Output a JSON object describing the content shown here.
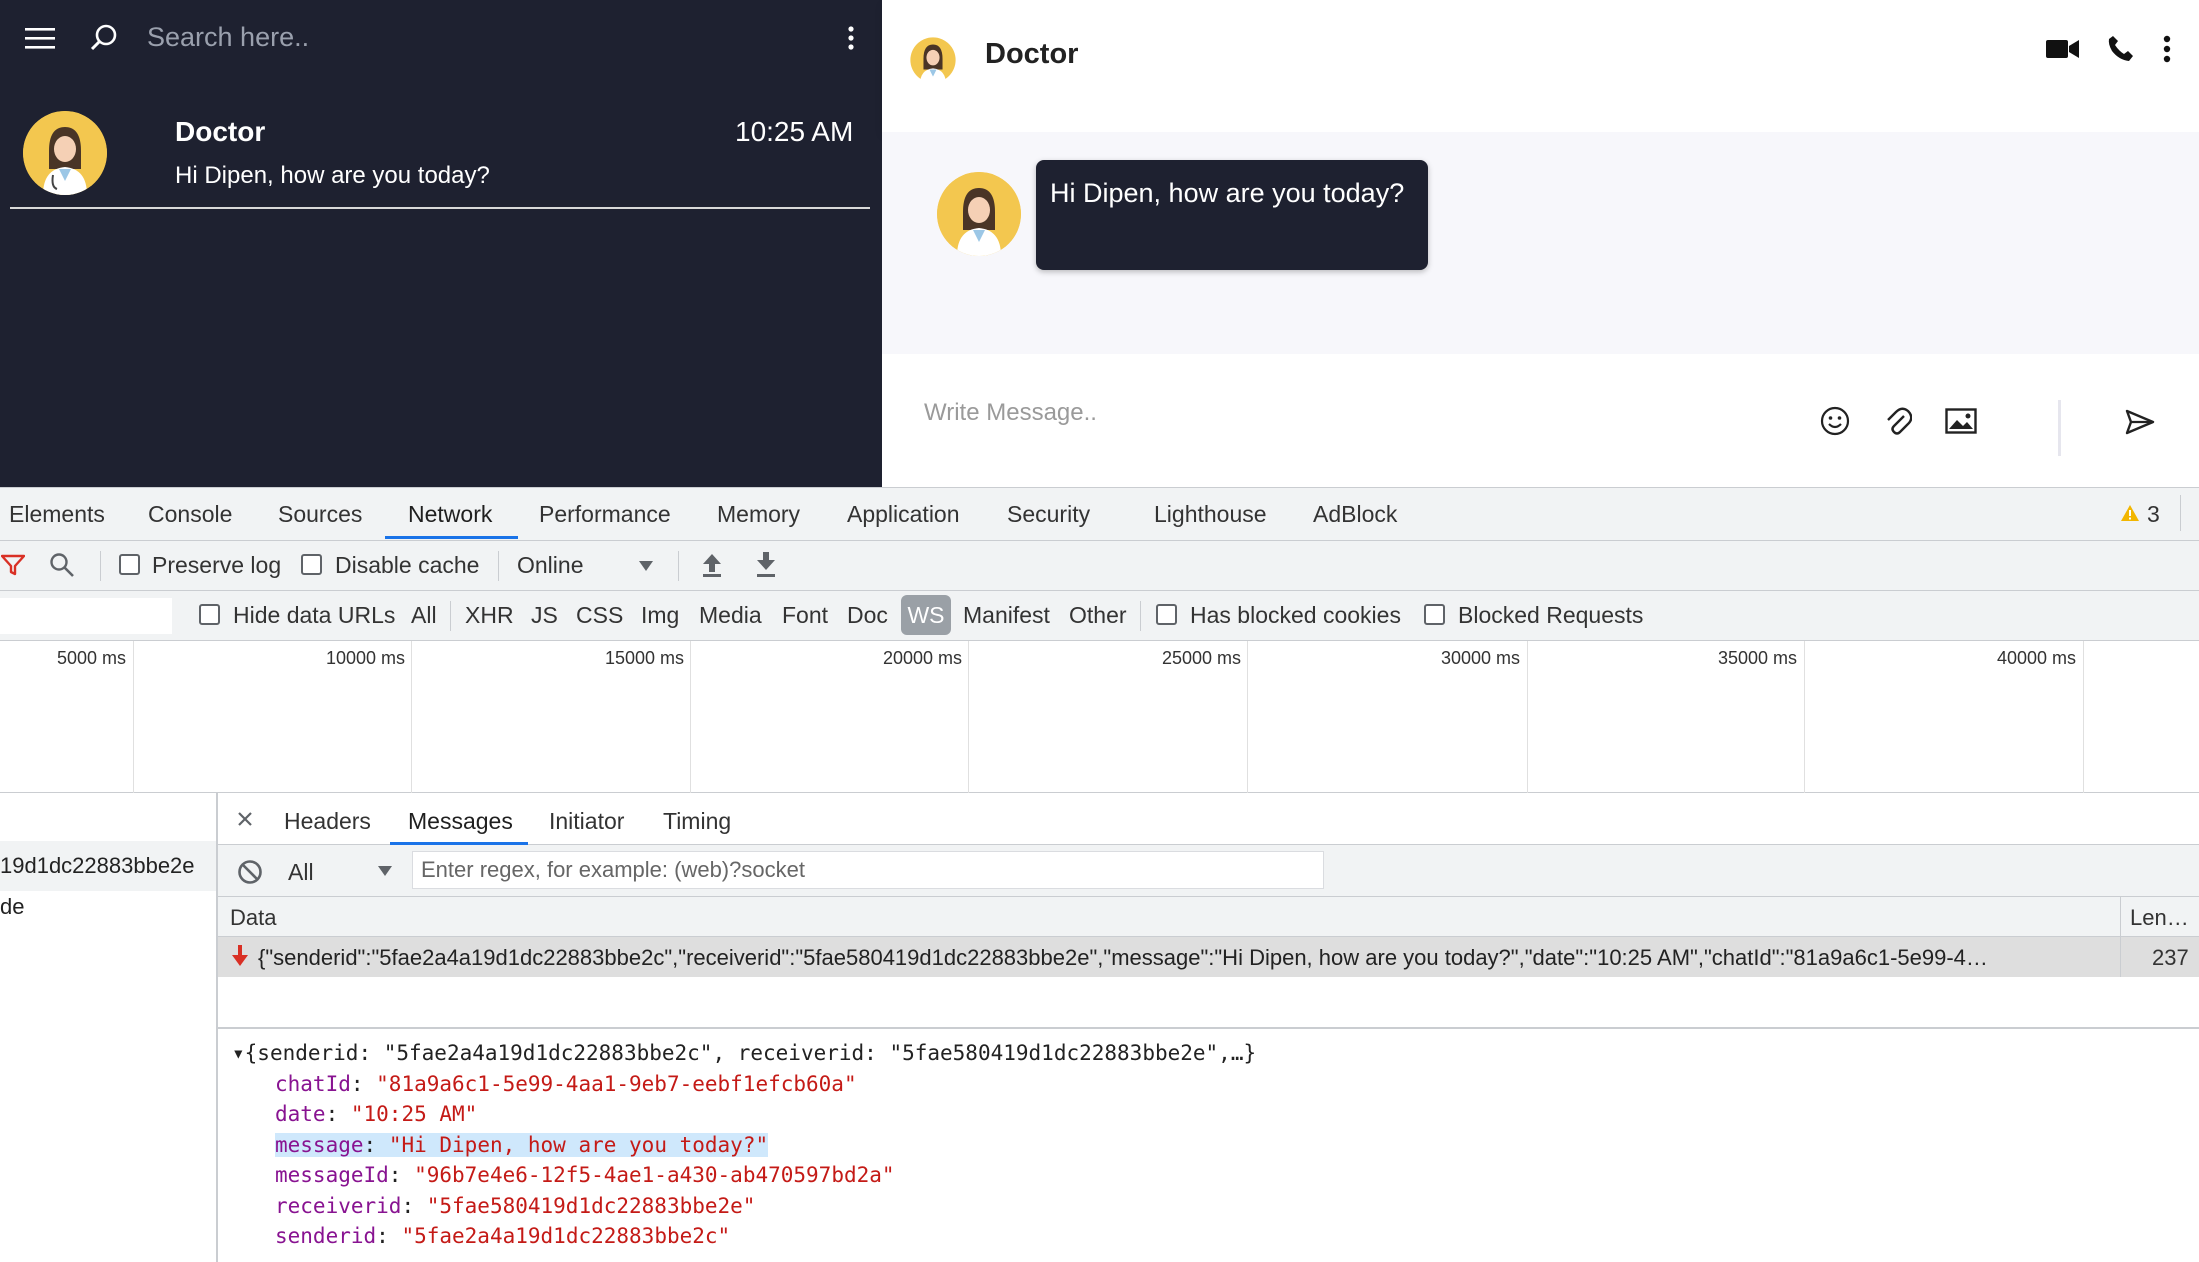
{
  "sidebar": {
    "search_placeholder": "Search here..",
    "chats": [
      {
        "name": "Doctor",
        "time": "10:25 AM",
        "preview": "Hi Dipen, how are you today?"
      }
    ]
  },
  "chat": {
    "contact_name": "Doctor",
    "messages": [
      {
        "text": "Hi Dipen, how are you today?"
      }
    ],
    "composer_placeholder": "Write Message.."
  },
  "devtools": {
    "tabs": [
      "Elements",
      "Console",
      "Sources",
      "Network",
      "Performance",
      "Memory",
      "Application",
      "Security",
      "Lighthouse",
      "AdBlock"
    ],
    "active_tab": "Network",
    "warning_count": "3",
    "toolbar": {
      "preserve_log": "Preserve log",
      "disable_cache": "Disable cache",
      "throttle": "Online"
    },
    "filters": {
      "hide_data_urls": "Hide data URLs",
      "types": [
        "All",
        "XHR",
        "JS",
        "CSS",
        "Img",
        "Media",
        "Font",
        "Doc",
        "WS",
        "Manifest",
        "Other"
      ],
      "active_type": "WS",
      "has_blocked_cookies": "Has blocked cookies",
      "blocked_requests": "Blocked Requests"
    },
    "timeline_ticks": [
      "5000 ms",
      "10000 ms",
      "15000 ms",
      "20000 ms",
      "25000 ms",
      "30000 ms",
      "35000 ms",
      "40000 ms"
    ],
    "requests": [
      "19d1dc22883bbe2e",
      "de"
    ],
    "detail_tabs": [
      "Headers",
      "Messages",
      "Initiator",
      "Timing"
    ],
    "active_detail_tab": "Messages",
    "message_filter": {
      "selected": "All",
      "placeholder": "Enter regex, for example: (web)?socket"
    },
    "columns": {
      "data": "Data",
      "length": "Len…"
    },
    "frame": {
      "data": "{\"senderid\":\"5fae2a4a19d1dc22883bbe2c\",\"receiverid\":\"5fae580419d1dc22883bbe2e\",\"message\":\"Hi Dipen, how are you today?\",\"date\":\"10:25 AM\",\"chatId\":\"81a9a6c1-5e99-4…",
      "length": "237"
    },
    "json_tree": {
      "summary": "{senderid: \"5fae2a4a19d1dc22883bbe2c\", receiverid: \"5fae580419d1dc22883bbe2e\",…}",
      "props": [
        {
          "key": "chatId",
          "value": "\"81a9a6c1-5e99-4aa1-9eb7-eebf1efcb60a\""
        },
        {
          "key": "date",
          "value": "\"10:25 AM\""
        },
        {
          "key": "message",
          "value": "\"Hi Dipen, how are you today?\""
        },
        {
          "key": "messageId",
          "value": "\"96b7e4e6-12f5-4ae1-a430-ab470597bd2a\""
        },
        {
          "key": "receiverid",
          "value": "\"5fae580419d1dc22883bbe2e\""
        },
        {
          "key": "senderid",
          "value": "\"5fae2a4a19d1dc22883bbe2c\""
        }
      ]
    }
  },
  "colors": {
    "sidebar_bg": "#1e2130",
    "accent": "#1a73e8",
    "json_key": "#881391",
    "json_value": "#c41a16"
  }
}
